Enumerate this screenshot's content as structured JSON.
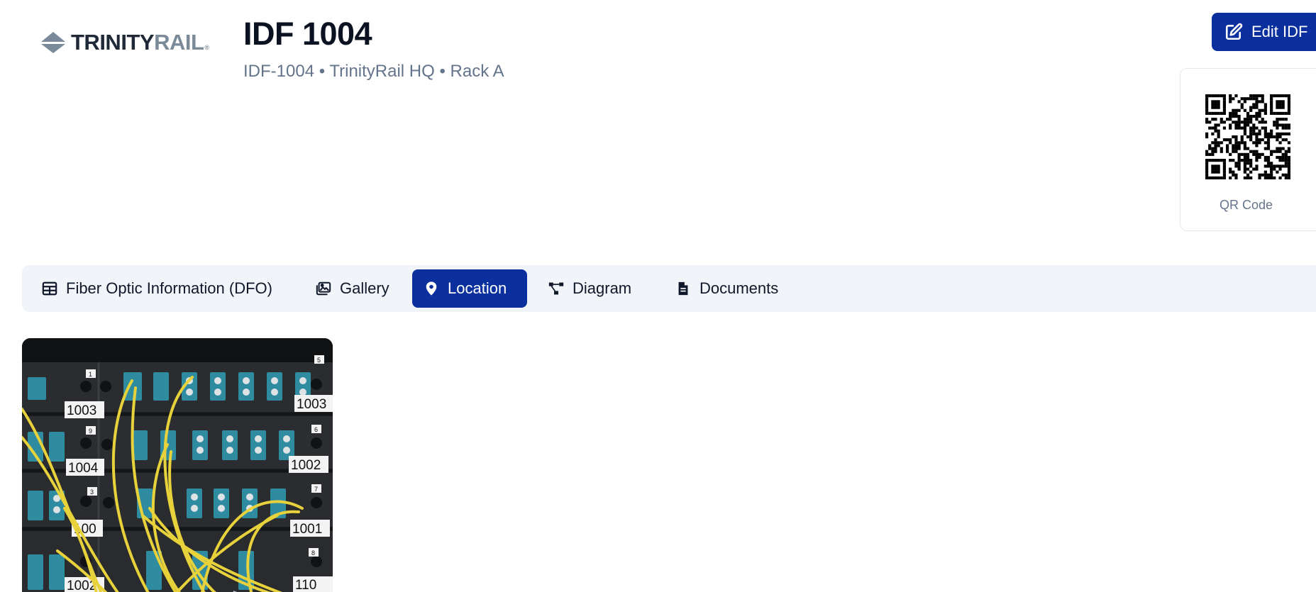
{
  "brand": {
    "logo_icon": "trinityrail-mark-icon",
    "name_part1": "TRINITY",
    "name_part2": "RAIL",
    "registered": "®"
  },
  "header": {
    "title": "IDF 1004",
    "subtitle": "IDF-1004 • TrinityRail HQ • Rack A",
    "edit_button": {
      "label": "Edit IDF",
      "icon": "edit-icon"
    }
  },
  "qr": {
    "caption": "QR Code"
  },
  "tabs": [
    {
      "label": "Fiber Optic Information (DFO)",
      "icon": "table-icon",
      "active": false
    },
    {
      "label": "Gallery",
      "icon": "images-icon",
      "active": false
    },
    {
      "label": "Location",
      "icon": "map-pin-icon",
      "active": true
    },
    {
      "label": "Diagram",
      "icon": "diagram-icon",
      "active": false
    },
    {
      "label": "Documents",
      "icon": "document-icon",
      "active": false
    }
  ],
  "photo": {
    "panel_labels": [
      "1003",
      "1003",
      "1004",
      "1002",
      "100",
      "1001",
      "1002",
      "110"
    ],
    "slot_numbers": [
      "1",
      "5",
      "9",
      "6",
      "3",
      "7",
      "8"
    ]
  },
  "colors": {
    "primary": "#0b309d",
    "tab_bg": "#f1f5f9",
    "subtitle": "#64748b"
  }
}
